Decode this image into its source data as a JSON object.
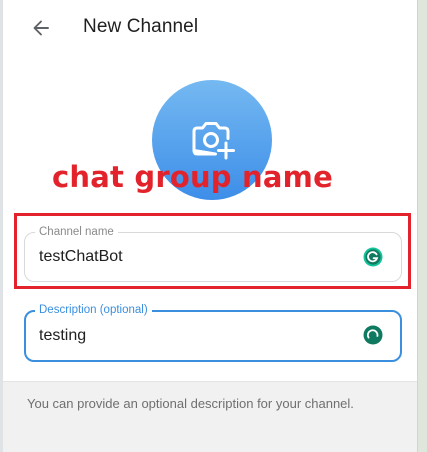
{
  "header": {
    "back_icon": "arrow-left-icon",
    "title": "New Channel"
  },
  "avatar": {
    "icon": "camera-add-icon",
    "color_top": "#75b9f1",
    "color_bottom": "#3d8ee9"
  },
  "annotation": {
    "text": "chat group name",
    "color": "#e2232b"
  },
  "channel_name": {
    "label": "Channel name",
    "value": "testChatBot",
    "assist_icon": "grammarly-icon"
  },
  "description": {
    "label": "Description (optional)",
    "value": "testing",
    "accent": "#3a8fdf",
    "assist_icon": "grammarly-icon"
  },
  "hint": {
    "text": "You can provide an optional description for your channel."
  }
}
